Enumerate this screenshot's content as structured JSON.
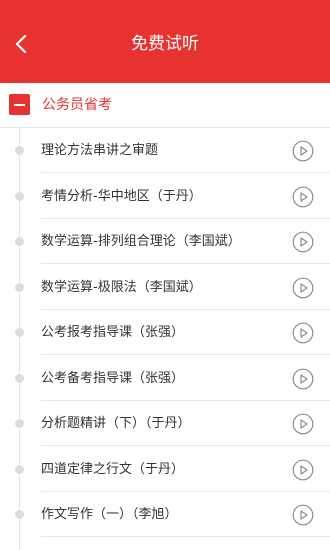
{
  "header": {
    "title": "免费试听",
    "back_icon": "back-arrow-icon",
    "color": "#e8322f"
  },
  "section": {
    "title": "公务员省考",
    "icon": "collapse-minus-icon"
  },
  "lessons": [
    {
      "title": "理论方法串讲之审题"
    },
    {
      "title": "考情分析-华中地区（于丹）"
    },
    {
      "title": "数学运算-排列组合理论（李国斌）"
    },
    {
      "title": "数学运算-极限法（李国斌）"
    },
    {
      "title": "公考报考指导课（张强）"
    },
    {
      "title": "公考备考指导课（张强）"
    },
    {
      "title": "分析题精讲（下）（于丹）"
    },
    {
      "title": "四道定律之行文（于丹）"
    },
    {
      "title": "作文写作（一）（李旭）"
    }
  ],
  "play_icon": "play-circle-icon"
}
